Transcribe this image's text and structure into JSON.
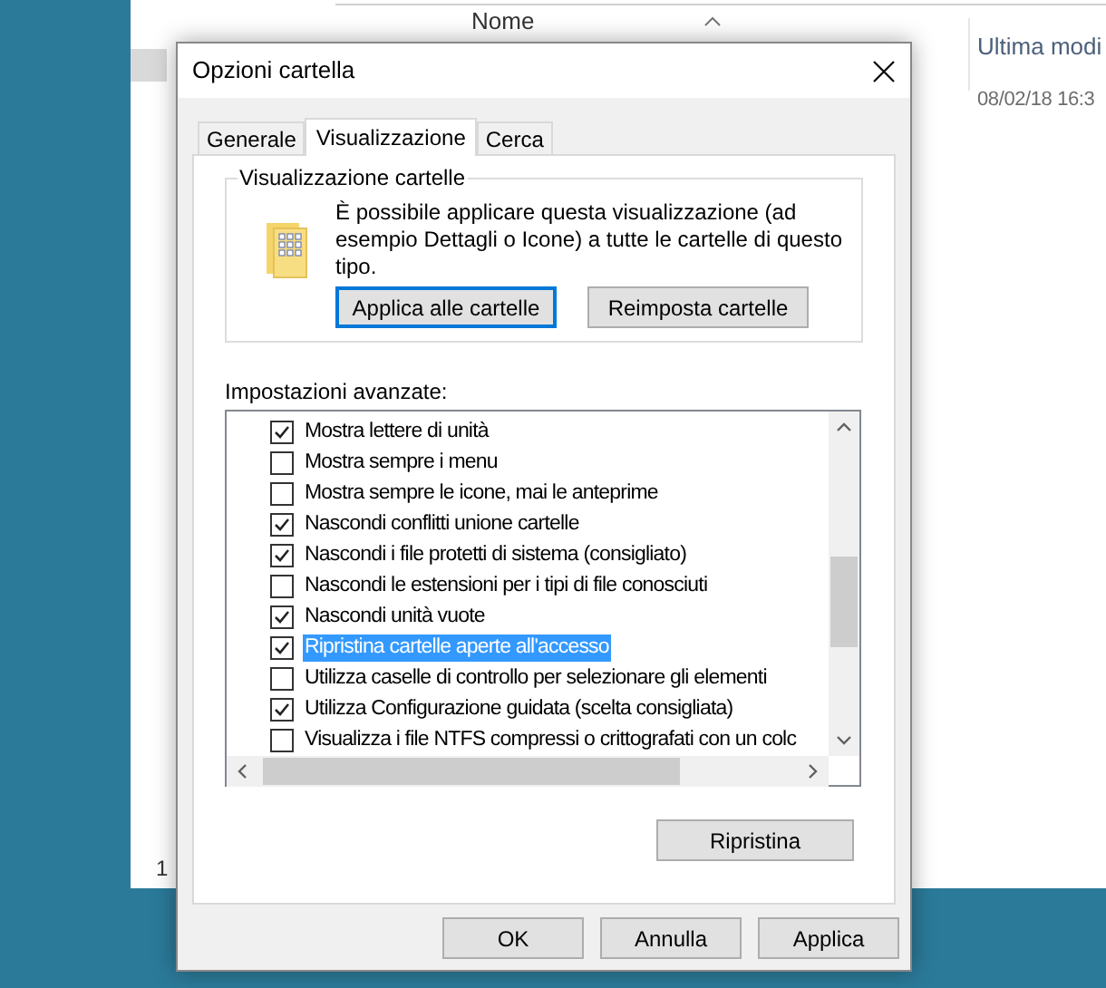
{
  "explorer": {
    "column_header": "Nome",
    "column_2_header": "Ultima modi",
    "cell": "08/02/18 16:3",
    "status_count": "1"
  },
  "dialog": {
    "title": "Opzioni cartella",
    "tabs": [
      {
        "label": "Generale",
        "selected": false
      },
      {
        "label": "Visualizzazione",
        "selected": true
      },
      {
        "label": "Cerca",
        "selected": false
      }
    ],
    "group": {
      "title": "Visualizzazione cartelle",
      "description": "È possibile applicare questa visualizzazione (ad esempio Dettagli o Icone) a tutte le cartelle di questo tipo.",
      "buttons": [
        {
          "label": "Applica alle cartelle",
          "focused": true
        },
        {
          "label": "Reimposta cartelle",
          "focused": false
        }
      ]
    },
    "advanced_label": "Impostazioni avanzate:",
    "settings": [
      {
        "label": "Mostra lettere di unità",
        "checked": true,
        "selected": false
      },
      {
        "label": "Mostra sempre i menu",
        "checked": false,
        "selected": false
      },
      {
        "label": "Mostra sempre le icone, mai le anteprime",
        "checked": false,
        "selected": false
      },
      {
        "label": "Nascondi conflitti unione cartelle",
        "checked": true,
        "selected": false
      },
      {
        "label": "Nascondi i file protetti di sistema (consigliato)",
        "checked": true,
        "selected": false
      },
      {
        "label": "Nascondi le estensioni per i tipi di file conosciuti",
        "checked": false,
        "selected": false
      },
      {
        "label": "Nascondi unità vuote",
        "checked": true,
        "selected": false
      },
      {
        "label": "Ripristina cartelle aperte all'accesso",
        "checked": true,
        "selected": true
      },
      {
        "label": "Utilizza caselle di controllo per selezionare gli elementi",
        "checked": false,
        "selected": false
      },
      {
        "label": "Utilizza Configurazione guidata (scelta consigliata)",
        "checked": true,
        "selected": false
      },
      {
        "label": "Visualizza i file NTFS compressi o crittografati con un colc",
        "checked": false,
        "selected": false
      }
    ],
    "restore_button": "Ripristina",
    "footer_buttons": [
      "OK",
      "Annulla",
      "Applica"
    ]
  }
}
